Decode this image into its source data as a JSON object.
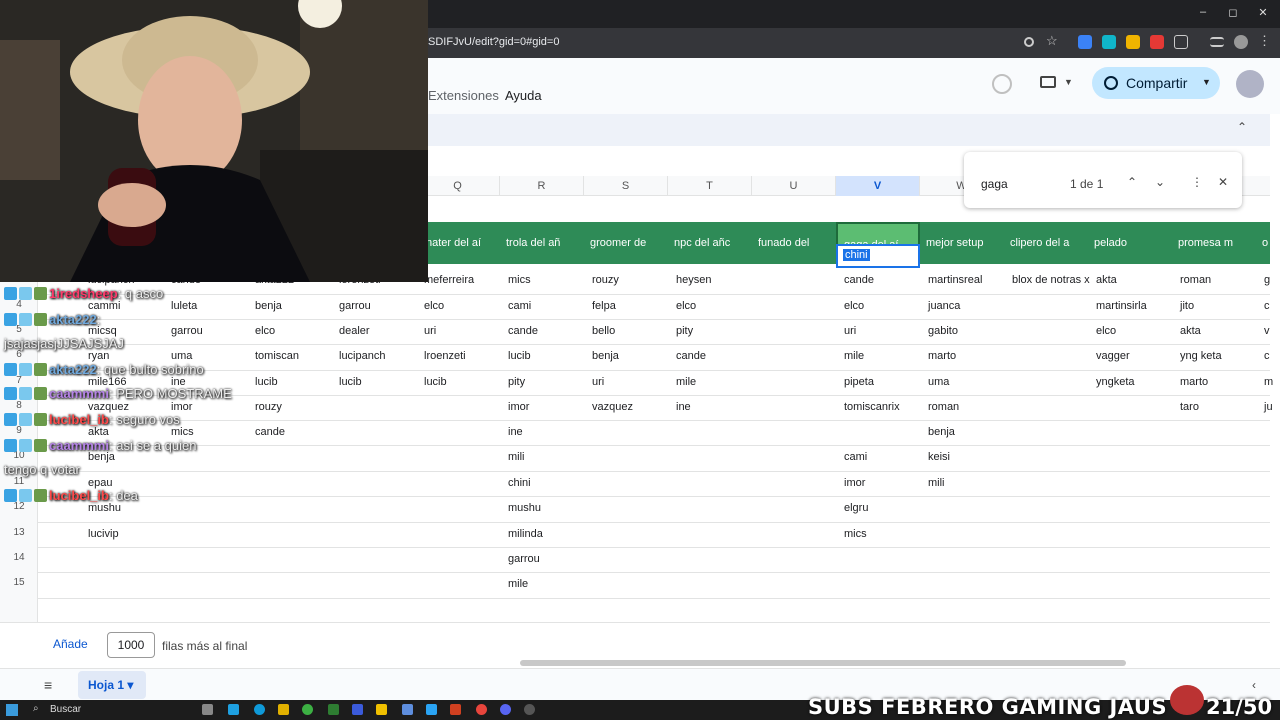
{
  "browser": {
    "url": "SDIFJvU/edit?gid=0#gid=0",
    "window_minimize": "–",
    "window_restore": "◻",
    "window_close": "✕"
  },
  "menu": {
    "extensions": "Extensiones",
    "help": "Ayuda",
    "share_label": "Compartir",
    "collapse": "⌃"
  },
  "find": {
    "query": "gaga",
    "count": "1 de 1",
    "prev": "⌃",
    "next": "⌄",
    "more": "⋮",
    "close": "✕"
  },
  "columns": [
    "Q",
    "R",
    "S",
    "T",
    "U",
    "V",
    "W"
  ],
  "headers": [
    "nater del aí",
    "trola del añ",
    "groomer de",
    "npc del añc",
    "funado del",
    "gaga del aí",
    "mejor setup",
    "clipero del a",
    "pelado",
    "promesa m",
    "o"
  ],
  "rows": [
    "3",
    "4",
    "5",
    "6",
    "7",
    "8",
    "9",
    "10",
    "11",
    "12",
    "13",
    "14",
    "15"
  ],
  "left_cells": [
    [
      "lucipanch",
      "cande",
      "akta222",
      "lorenzeti",
      "meferreira"
    ],
    [
      "cammi",
      "luleta",
      "benja",
      "garrou",
      "elco"
    ],
    [
      "micsq",
      "garrou",
      "elco",
      "dealer",
      "uri"
    ],
    [
      "ryan",
      "uma",
      "tomiscan",
      "lucipanch",
      "lroenzeti"
    ],
    [
      "mile166",
      "ine",
      "lucib",
      "lucib",
      "lucib"
    ],
    [
      "vazquez",
      "imor",
      "rouzy",
      "",
      ""
    ],
    [
      "akta",
      "mics",
      "cande",
      "",
      ""
    ],
    [
      "benja",
      "",
      "",
      "",
      ""
    ],
    [
      "epau",
      "",
      "",
      "",
      ""
    ],
    [
      "mushu",
      "",
      "",
      "",
      ""
    ],
    [
      "lucivip",
      "",
      "",
      "",
      ""
    ]
  ],
  "cells": [
    [
      "mics",
      "rouzy",
      "heysen",
      "",
      "cande",
      "martinsreal",
      "blox de notras x",
      "akta",
      "roman",
      "g"
    ],
    [
      "cami",
      "felpa",
      "elco",
      "",
      "elco",
      "juanca",
      "",
      "martinsirla",
      "jito",
      "c"
    ],
    [
      "cande",
      "bello",
      "pity",
      "",
      "uri",
      "gabito",
      "",
      "elco",
      "akta",
      "v"
    ],
    [
      "lucib",
      "benja",
      "cande",
      "",
      "mile",
      "marto",
      "",
      "vagger",
      "yng keta",
      "c"
    ],
    [
      "pity",
      "uri",
      "mile",
      "",
      "pipeta",
      "uma",
      "",
      "yngketa",
      "marto",
      "m"
    ],
    [
      "imor",
      "vazquez",
      "ine",
      "",
      "tomiscanrix",
      "roman",
      "",
      "",
      "taro",
      "ju"
    ],
    [
      "ine",
      "",
      "",
      "",
      "",
      "benja",
      "",
      "",
      "",
      ""
    ],
    [
      "mili",
      "",
      "",
      "",
      "cami",
      "keisi",
      "",
      "",
      "",
      ""
    ],
    [
      "chini",
      "",
      "",
      "",
      "imor",
      "mili",
      "",
      "",
      "",
      ""
    ],
    [
      "mushu",
      "",
      "",
      "",
      "elgru",
      "",
      "",
      "",
      "",
      ""
    ],
    [
      "milinda",
      "",
      "",
      "",
      "mics",
      "",
      "",
      "",
      "",
      ""
    ],
    [
      "garrou",
      "",
      "",
      "",
      "",
      "",
      "",
      "",
      "",
      ""
    ],
    [
      "mile",
      "",
      "",
      "",
      "",
      "",
      "",
      "",
      "",
      ""
    ]
  ],
  "selected_cell_value": "chini",
  "bottom": {
    "add_label": "Añade",
    "rows_value": "1000",
    "rows_text": "filas más al final"
  },
  "sheet": {
    "menu_icon": "≡",
    "tab_name": "Hoja 1",
    "tab_caret": "▾",
    "nav_left": "‹"
  },
  "taskbar": {
    "search_label": "Buscar"
  },
  "overlay": {
    "subs_text": "SUBS FEBRERO GAMING JAUS",
    "subs_count": "21/50"
  },
  "chat": [
    {
      "user": "1iredsheep",
      "color": "#ff3b6b",
      "msg": ": q asco"
    },
    {
      "user": "akta222",
      "color": "#6fa8dc",
      "msg": ":"
    },
    {
      "user": "",
      "color": "#ffffff",
      "msg": "jsajasjasjJJSAJSJAJ"
    },
    {
      "user": "akta222",
      "color": "#6fa8dc",
      "msg": ": que bulto sobrino"
    },
    {
      "user": "caammmi",
      "color": "#b583e6",
      "msg": ": PERO MOSTRAME"
    },
    {
      "user": "lucibel_ib",
      "color": "#ff4b4b",
      "msg": ": seguro vos"
    },
    {
      "user": "caammmi",
      "color": "#b583e6",
      "msg": ": asi se a quien"
    },
    {
      "user": "",
      "color": "#ffffff",
      "msg": "tengo q votar"
    },
    {
      "user": "lucibel_ib",
      "color": "#ff4b4b",
      "msg": ": dea"
    }
  ]
}
